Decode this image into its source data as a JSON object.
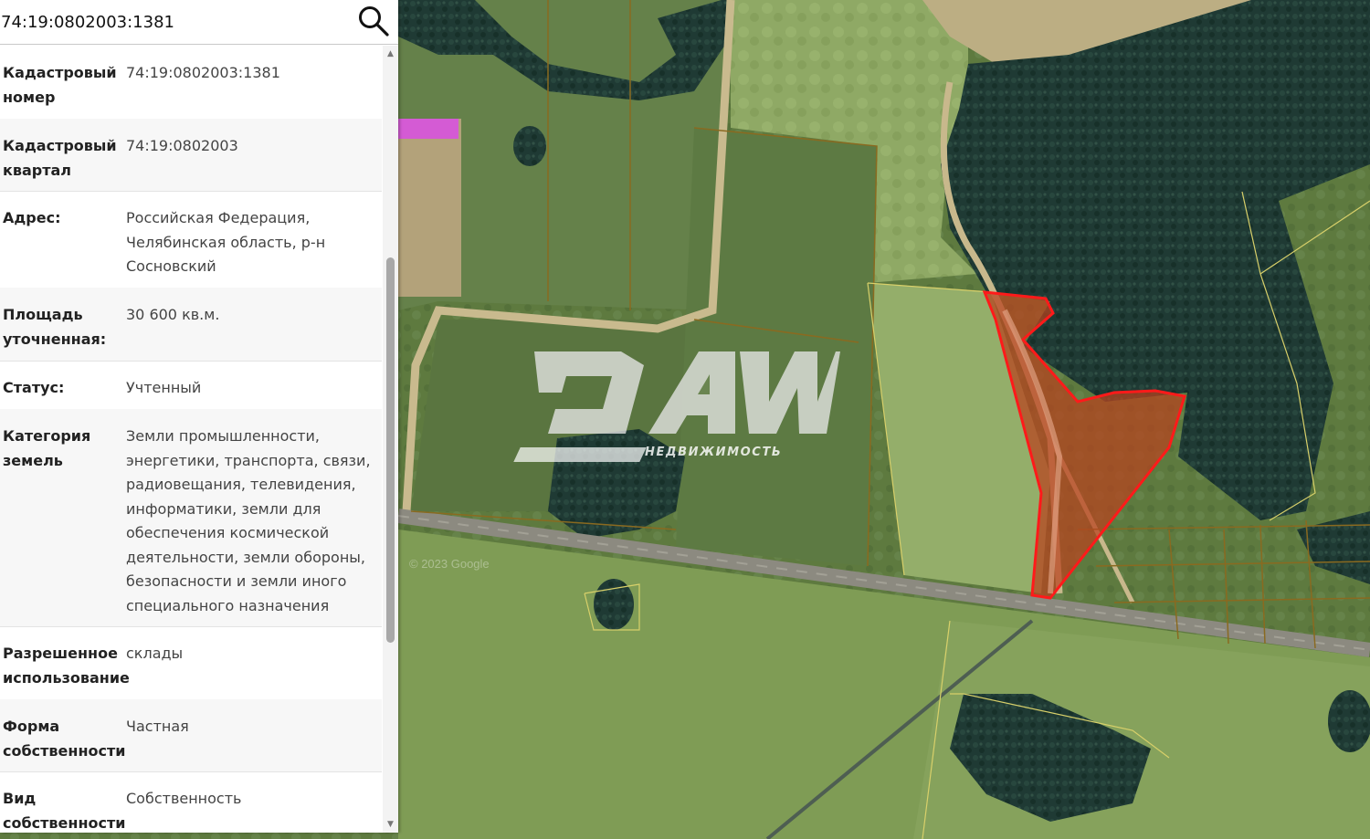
{
  "search": {
    "value": "74:19:0802003:1381",
    "button_icon": "search-icon"
  },
  "info_rows": [
    {
      "label": "Кадастровый номер",
      "value": "74:19:0802003:1381"
    },
    {
      "label": "Кадастровый квартал",
      "value": "74:19:0802003"
    },
    {
      "label": "Адрес:",
      "value": "Российская Федерация, Челябинская область, р-н Сосновский"
    },
    {
      "label": "Площадь уточненная:",
      "value": "30 600 кв.м."
    },
    {
      "label": "Статус:",
      "value": "Учтенный"
    },
    {
      "label": "Категория земель",
      "value": "Земли промышленности, энергетики, транспорта, связи, радиовещания, телевидения, информатики, земли для обеспечения космической деятельности, земли обороны, безопасности и земли иного специального назначения"
    },
    {
      "label": "Разрешенное использование",
      "value": "склады"
    },
    {
      "label": "Форма собственности",
      "value": "Частная"
    },
    {
      "label": "Вид собственности",
      "value": "Собственность"
    }
  ],
  "watermark": {
    "logo": "DAW",
    "subtitle": "НЕДВИЖИМОСТЬ"
  },
  "map_attribution": "© 2023 Google",
  "colors": {
    "selected_parcel_fill": "#b8431f",
    "selected_parcel_border": "#ff1a1a",
    "parcel_border": "#8a6a20",
    "highlight_parcel": "#d45bd4"
  }
}
